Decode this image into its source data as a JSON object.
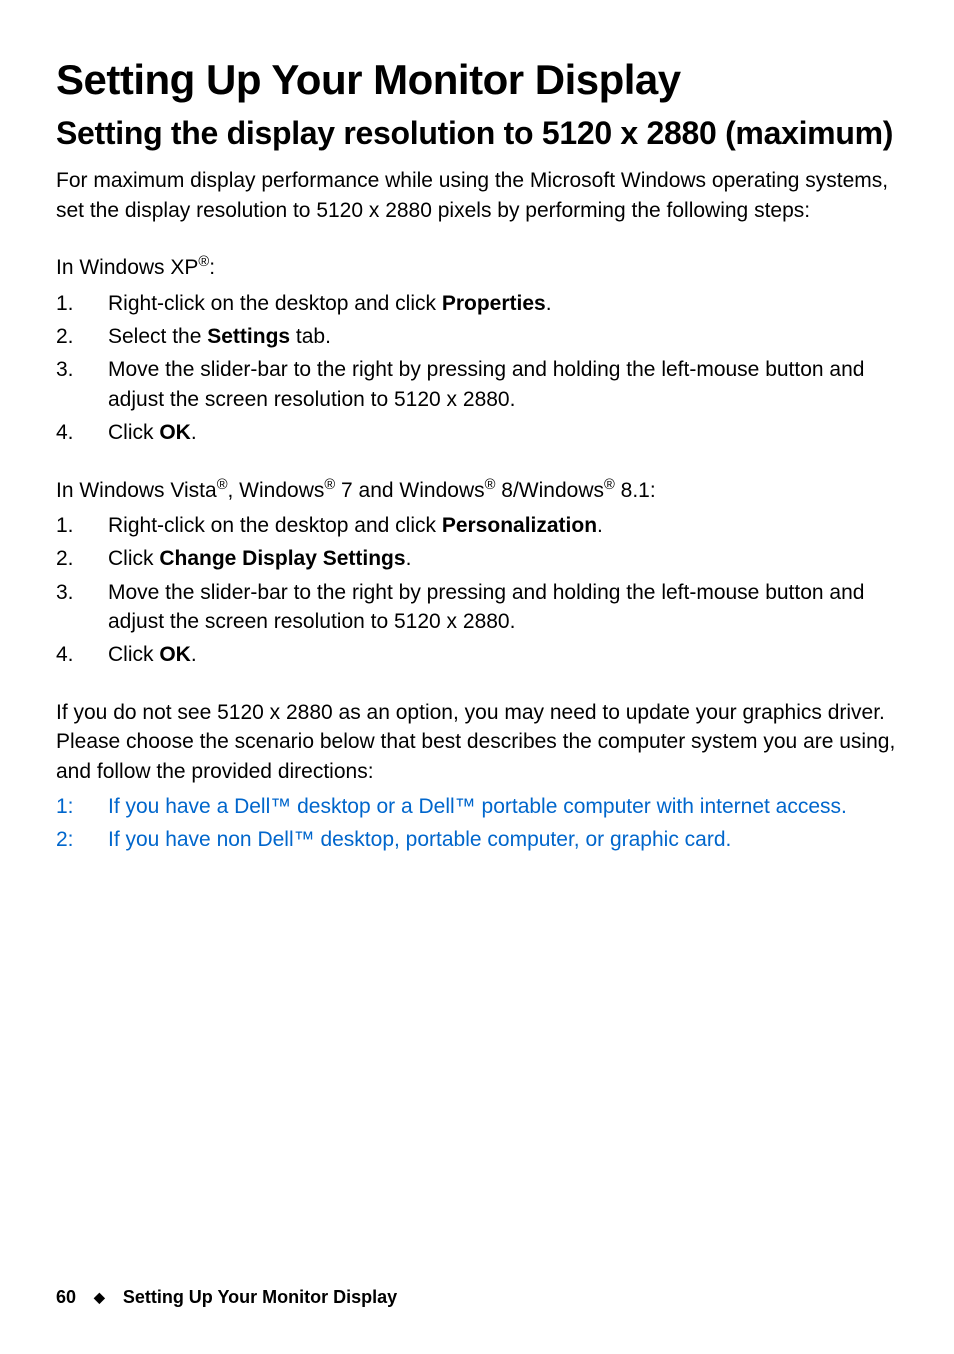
{
  "h1": "Setting Up Your Monitor Display",
  "h2": "Setting the display resolution to 5120 x 2880 (maximum)",
  "intro": "For maximum display performance while using the Microsoft Windows operating systems, set the display resolution to 5120 x 2880 pixels by performing the following steps:",
  "sectionA": {
    "label_pre": "In Windows XP",
    "label_post": ":",
    "reg": "®",
    "steps": [
      {
        "num": "1.",
        "parts": [
          "Right-click on the desktop and click ",
          {
            "b": "Properties"
          },
          "."
        ]
      },
      {
        "num": "2.",
        "parts": [
          "Select the ",
          {
            "b": "Settings"
          },
          " tab."
        ]
      },
      {
        "num": "3.",
        "parts": [
          "Move the slider-bar to the right by pressing and holding the left-mouse button and adjust the screen resolution to 5120 x 2880."
        ]
      },
      {
        "num": "4.",
        "parts": [
          "Click ",
          {
            "b": "OK"
          },
          "."
        ]
      }
    ]
  },
  "sectionB": {
    "label_parts": [
      "In Windows Vista",
      {
        "sup": "®"
      },
      ", Windows",
      {
        "sup": "®"
      },
      " 7 and Windows",
      {
        "sup": "®"
      },
      " 8/Windows",
      {
        "sup": "®"
      },
      " 8.1:"
    ],
    "steps": [
      {
        "num": "1.",
        "parts": [
          "Right-click on the desktop and click ",
          {
            "b": "Personalization"
          },
          "."
        ]
      },
      {
        "num": "2.",
        "parts": [
          "Click ",
          {
            "b": "Change Display Settings"
          },
          "."
        ]
      },
      {
        "num": "3.",
        "parts": [
          "Move the slider-bar to the right by pressing and holding the left-mouse button and adjust the screen resolution to 5120 x 2880."
        ]
      },
      {
        "num": "4.",
        "parts": [
          "Click ",
          {
            "b": "OK"
          },
          "."
        ]
      }
    ]
  },
  "driver_note": "If you do not see 5120 x 2880 as an option, you may need to update your graphics driver. Please choose the scenario below that best describes the computer system you are using, and follow the provided directions:",
  "links": [
    {
      "num": "1:",
      "text": "If you have a Dell™ desktop or a Dell™ portable computer with internet access."
    },
    {
      "num": "2:",
      "text": "If you have non Dell™ desktop, portable computer, or graphic card."
    }
  ],
  "footer": {
    "page": "60",
    "diamond": "◆",
    "label": "Setting Up Your Monitor Display"
  }
}
